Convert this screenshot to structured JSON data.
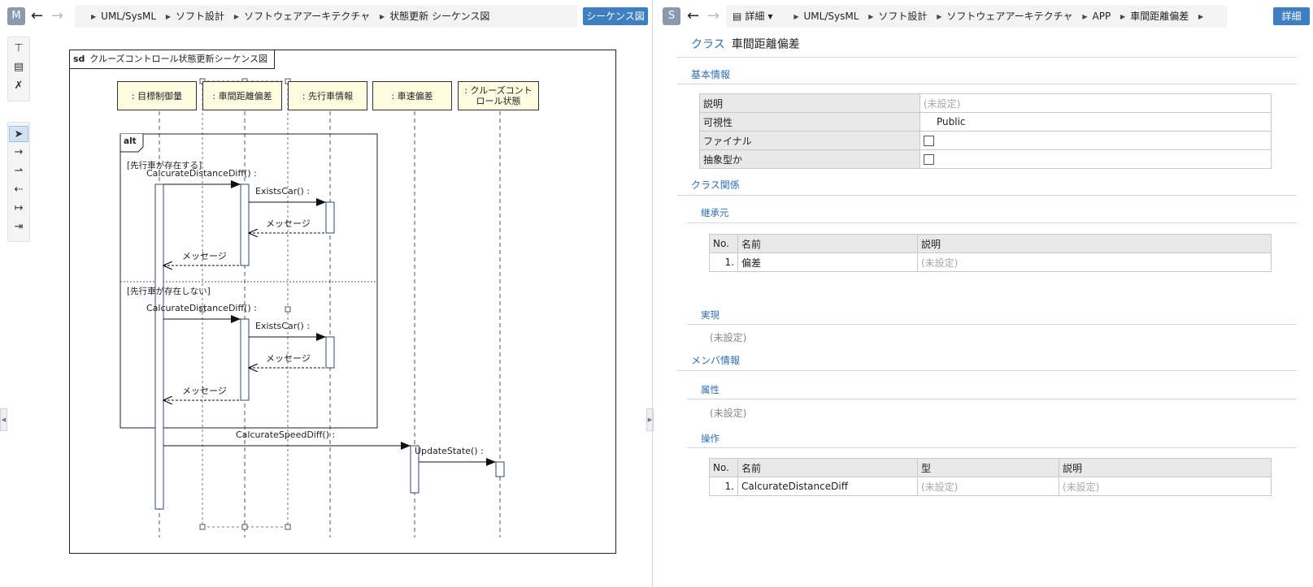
{
  "left": {
    "avatar": "M",
    "breadcrumb": [
      "UML/SysML",
      "ソフト設計",
      "ソフトウェアアーキテクチャ",
      "状態更新 シーケンス図"
    ],
    "view_button": "シーケンス図",
    "diagram": {
      "frame_kind": "sd",
      "frame_title": "クルーズコントロール状態更新シーケンス図",
      "lifelines": [
        ": 目標制御量",
        ": 車間距離偏差",
        ": 先行車情報",
        ": 車速偏差",
        ": クルーズコントロール状態"
      ],
      "fragment_operator": "alt",
      "guard_1": "[先行車が存在する]",
      "guard_2": "[先行車が存在しない]",
      "messages": {
        "m1": "CalcurateDistanceDiff() :",
        "m2": "ExistsCar() :",
        "m3": "メッセージ",
        "m4": "メッセージ",
        "m5": "CalcurateDistanceDiff() :",
        "m6": "ExistsCar() :",
        "m7": "メッセージ",
        "m8": "メッセージ",
        "m9": "CalcurateSpeedDiff() :",
        "m10": "UpdateState() :"
      }
    }
  },
  "right": {
    "avatar": "S",
    "view_mode": "詳細",
    "breadcrumb": [
      "UML/SysML",
      "ソフト設計",
      "ソフトウェアアーキテクチャ",
      "APP",
      "車間距離偏差"
    ],
    "detail_button": "詳細",
    "title_kind": "クラス",
    "title_name": "車間距離偏差",
    "basic_info": {
      "heading": "基本情報",
      "rows": [
        {
          "key": "説明",
          "value": "(未設定)"
        },
        {
          "key": "可視性",
          "value": "Public"
        },
        {
          "key": "ファイナル",
          "value": ""
        },
        {
          "key": "抽象型か",
          "value": ""
        }
      ]
    },
    "class_relations": {
      "heading": "クラス関係",
      "inheritance_heading": "継承元",
      "inheritance_columns": [
        "No.",
        "名前",
        "説明"
      ],
      "inheritance_rows": [
        {
          "no": "1.",
          "name": "偏差",
          "desc": "(未設定)"
        }
      ],
      "realization_heading": "実現",
      "realization_value": "(未設定)"
    },
    "members": {
      "heading": "メンバ情報",
      "attributes_heading": "属性",
      "attributes_value": "(未設定)",
      "operations_heading": "操作",
      "operations_columns": [
        "No.",
        "名前",
        "型",
        "説明"
      ],
      "operations_rows": [
        {
          "no": "1.",
          "name": "CalcurateDistanceDiff",
          "type": "(未設定)",
          "desc": "(未設定)"
        }
      ]
    }
  }
}
